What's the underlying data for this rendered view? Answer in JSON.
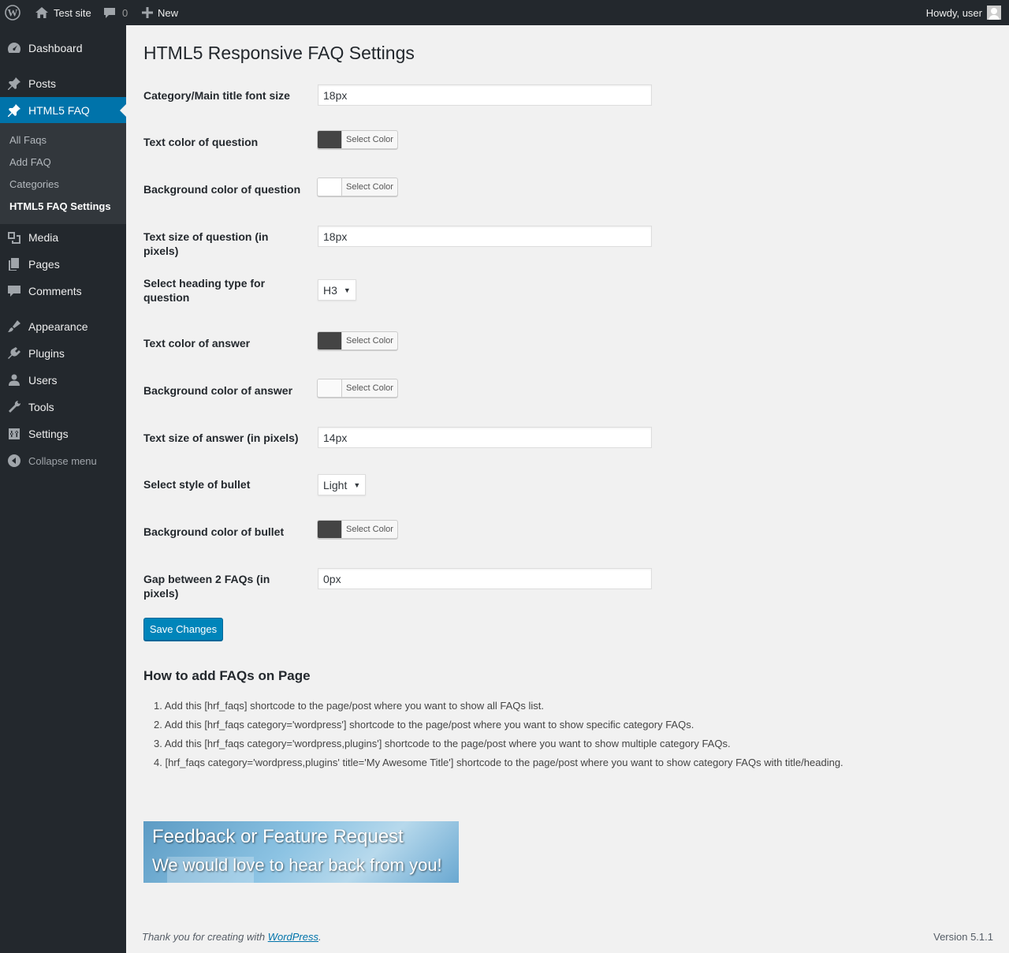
{
  "adminbar": {
    "site_name": "Test site",
    "comments_count": "0",
    "new_label": "New",
    "howdy": "Howdy, user"
  },
  "sidebar": {
    "items": [
      {
        "label": "Dashboard",
        "icon": "dashboard-icon"
      },
      {
        "label": "Posts",
        "icon": "pin-icon"
      },
      {
        "label": "HTML5 FAQ",
        "icon": "pin-icon"
      },
      {
        "label": "Media",
        "icon": "media-icon"
      },
      {
        "label": "Pages",
        "icon": "pages-icon"
      },
      {
        "label": "Comments",
        "icon": "comments-icon"
      },
      {
        "label": "Appearance",
        "icon": "appearance-icon"
      },
      {
        "label": "Plugins",
        "icon": "plugins-icon"
      },
      {
        "label": "Users",
        "icon": "users-icon"
      },
      {
        "label": "Tools",
        "icon": "tools-icon"
      },
      {
        "label": "Settings",
        "icon": "settings-icon"
      }
    ],
    "submenu": [
      "All Faqs",
      "Add FAQ",
      "Categories",
      "HTML5 FAQ Settings"
    ],
    "collapse_label": "Collapse menu"
  },
  "page": {
    "title": "HTML5 Responsive FAQ Settings",
    "select_color_label": "Select Color",
    "fields": {
      "main_title_font_size": {
        "label": "Category/Main title font size",
        "value": "18px"
      },
      "question_text_color": {
        "label": "Text color of question",
        "color": "#444444"
      },
      "question_bg_color": {
        "label": "Background color of question",
        "color": "#ffffff"
      },
      "question_text_size": {
        "label": "Text size of question (in pixels)",
        "value": "18px"
      },
      "question_heading_type": {
        "label": "Select heading type for question",
        "value": "H3"
      },
      "answer_text_color": {
        "label": "Text color of answer",
        "color": "#444444"
      },
      "answer_bg_color": {
        "label": "Background color of answer",
        "color": "#fafafa"
      },
      "answer_text_size": {
        "label": "Text size of answer (in pixels)",
        "value": "14px"
      },
      "bullet_style": {
        "label": "Select style of bullet",
        "value": "Light"
      },
      "bullet_bg_color": {
        "label": "Background color of bullet",
        "color": "#444444"
      },
      "faq_gap": {
        "label": "Gap between 2 FAQs (in pixels)",
        "value": "0px"
      }
    },
    "save_label": "Save Changes",
    "howto_title": "How to add FAQs on Page",
    "howto_steps": [
      "1. Add this [hrf_faqs] shortcode to the page/post where you want to show all FAQs list.",
      "2. Add this [hrf_faqs category='wordpress'] shortcode to the page/post where you want to show specific category FAQs.",
      "3. Add this [hrf_faqs category='wordpress,plugins'] shortcode to the page/post where you want to show multiple category FAQs.",
      "4. [hrf_faqs category='wordpress,plugins' title='My Awesome Title'] shortcode to the page/post where you want to show category FAQs with title/heading."
    ],
    "banner": {
      "line1": "Feedback or Feature Request",
      "line2": "We would love to hear back from you!"
    }
  },
  "footer": {
    "thanks_prefix": "Thank you for creating with ",
    "wordpress_link": "WordPress",
    "thanks_suffix": ".",
    "version": "Version 5.1.1"
  }
}
